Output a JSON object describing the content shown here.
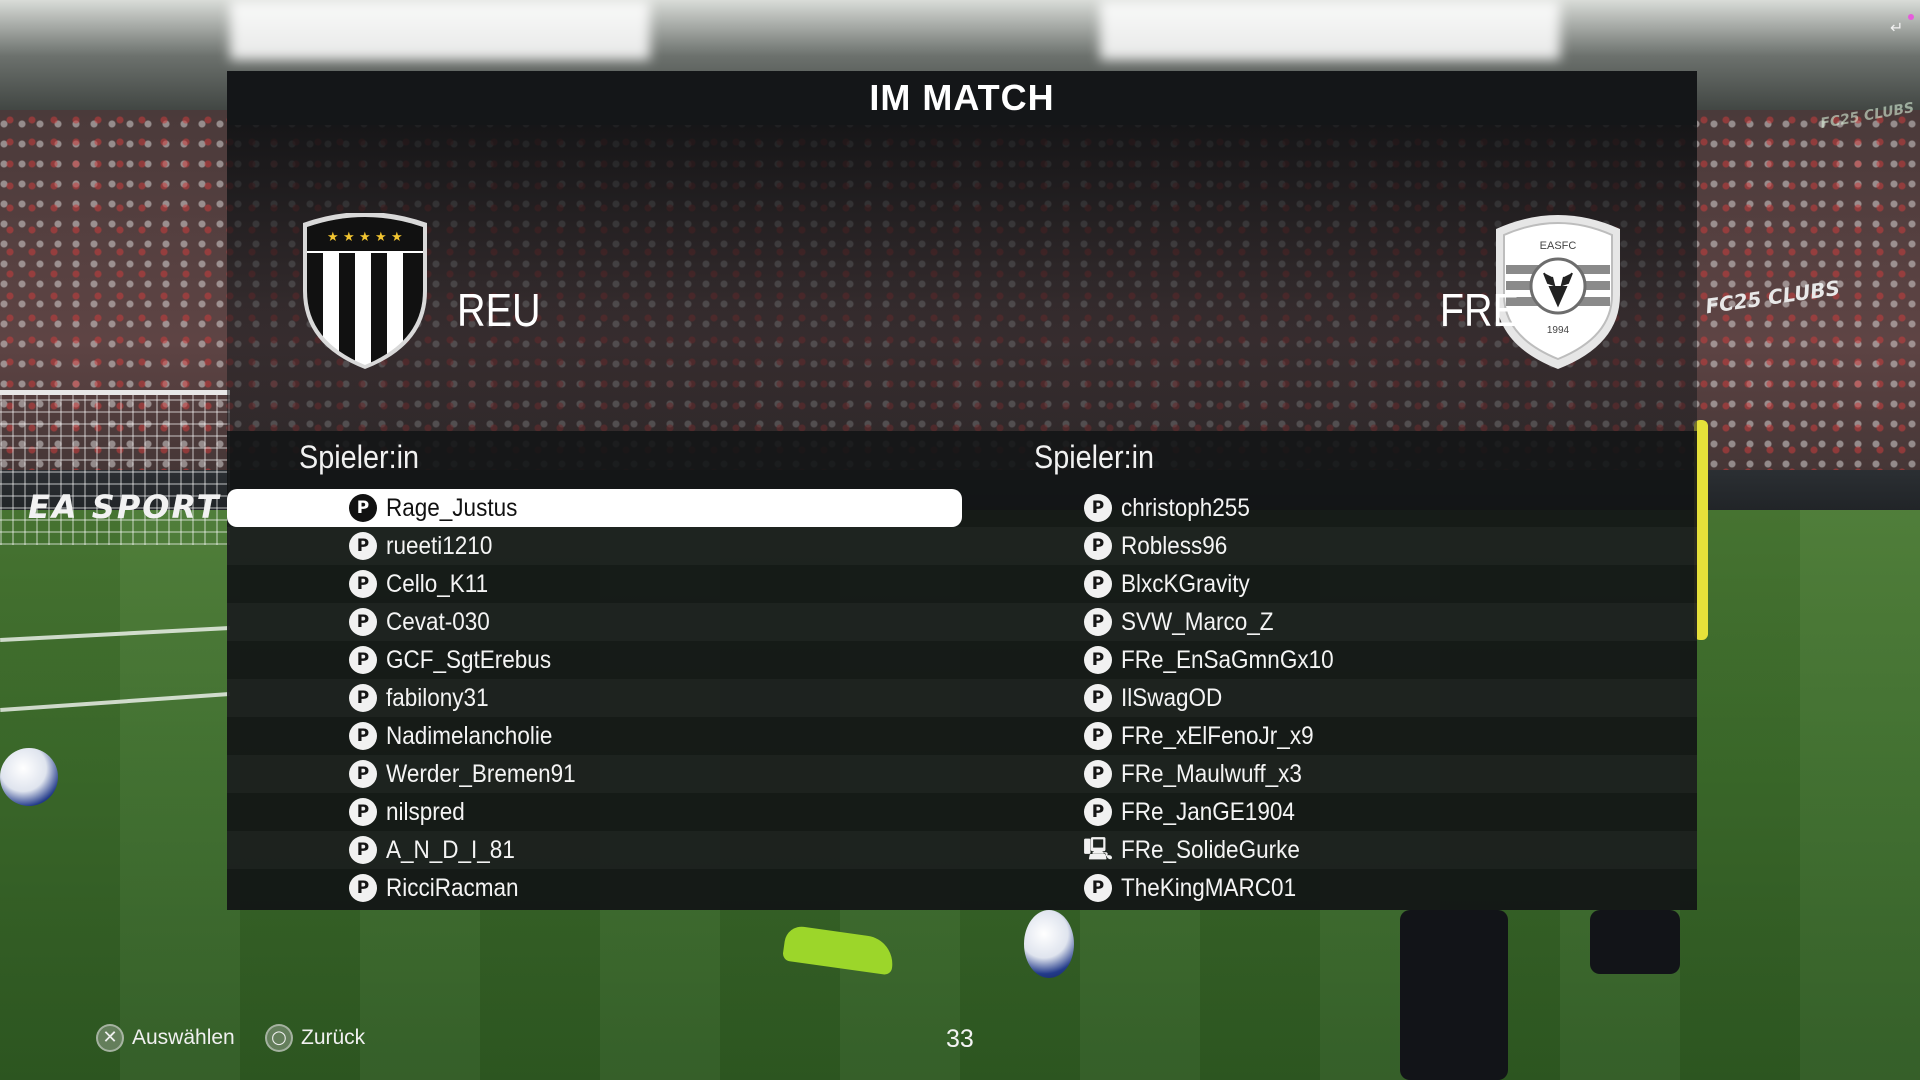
{
  "screen": {
    "title": "IM MATCH",
    "timer": "33"
  },
  "home": {
    "abbr": "REU",
    "crest_icon": "black-white-striped-shield-with-stars",
    "column_header": "Spieler:in",
    "players": [
      {
        "name": "Rage_Justus",
        "platform": "playstation-icon",
        "selected": true
      },
      {
        "name": "rueeti1210",
        "platform": "playstation-icon"
      },
      {
        "name": "Cello_K11",
        "platform": "playstation-icon"
      },
      {
        "name": "Cevat-030",
        "platform": "playstation-icon"
      },
      {
        "name": "GCF_SgtErebus",
        "platform": "playstation-icon"
      },
      {
        "name": "fabilony31",
        "platform": "playstation-icon"
      },
      {
        "name": "Nadimelancholie",
        "platform": "playstation-icon"
      },
      {
        "name": "Werder_Bremen91",
        "platform": "playstation-icon"
      },
      {
        "name": "nilspred",
        "platform": "playstation-icon"
      },
      {
        "name": "A_N_D_I_81",
        "platform": "playstation-icon"
      },
      {
        "name": "RicciRacman",
        "platform": "playstation-icon"
      }
    ]
  },
  "away": {
    "abbr": "FRE",
    "crest_icon": "easfc-deer-shield",
    "crest_text_top": "EASFC",
    "crest_text_bottom": "1994",
    "column_header": "Spieler:in",
    "players": [
      {
        "name": "christoph255",
        "platform": "playstation-icon"
      },
      {
        "name": "Robless96",
        "platform": "playstation-icon"
      },
      {
        "name": "BlxcKGravity",
        "platform": "playstation-icon"
      },
      {
        "name": "SVW_Marco_Z",
        "platform": "playstation-icon"
      },
      {
        "name": "FRe_EnSaGmnGx10",
        "platform": "playstation-icon"
      },
      {
        "name": "IlSwagOD",
        "platform": "playstation-icon"
      },
      {
        "name": "FRe_xElFenoJr_x9",
        "platform": "playstation-icon"
      },
      {
        "name": "FRe_Maulwuff_x3",
        "platform": "playstation-icon"
      },
      {
        "name": "FRe_JanGE1904",
        "platform": "playstation-icon"
      },
      {
        "name": "FRe_SolideGurke",
        "platform": "pc-icon"
      },
      {
        "name": "TheKingMARC01",
        "platform": "playstation-icon"
      }
    ]
  },
  "footer": {
    "select_label": "Auswählen",
    "select_icon": "cross-button-icon",
    "back_label": "Zurück",
    "back_icon": "circle-button-icon"
  },
  "background": {
    "sponsor_left": "EA SPORT",
    "sponsor_right": "FC25 CLUBS"
  },
  "colors": {
    "panel": "#141618",
    "selected_row": "#ffffff",
    "text": "#f4f4f4"
  }
}
